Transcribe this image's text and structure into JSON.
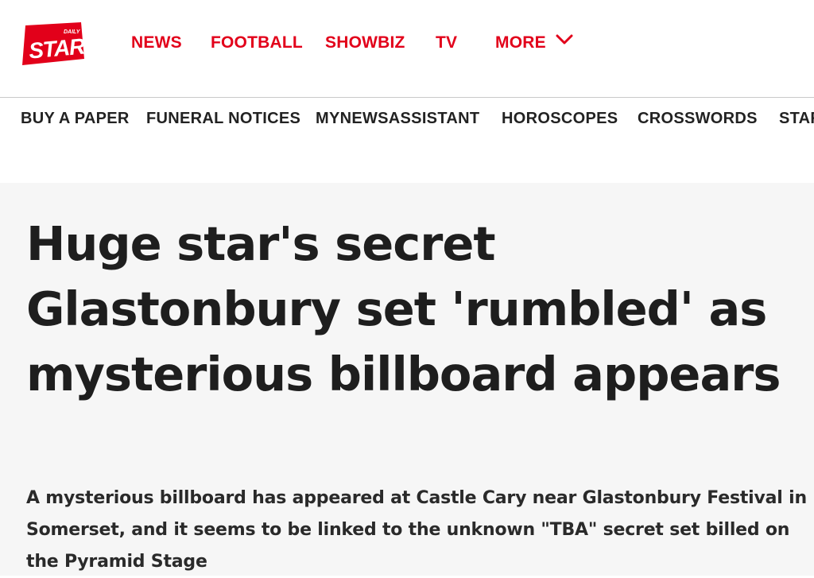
{
  "brand": {
    "logo_top": "DAILY",
    "logo_main": "STAR",
    "color": "#e2001a"
  },
  "main_nav": {
    "items": [
      "NEWS",
      "FOOTBALL",
      "SHOWBIZ",
      "TV",
      "MORE"
    ],
    "more_icon": "chevron-down-icon"
  },
  "sub_nav": {
    "items": [
      "BUY A PAPER",
      "FUNERAL NOTICES",
      "MYNEWSASSISTANT",
      "HOROSCOPES",
      "CROSSWORDS",
      "STAR"
    ]
  },
  "article": {
    "headline": "Huge star's secret Glastonbury set 'rumbled' as mysterious billboard appears",
    "standfirst": "A mysterious billboard has appeared at Castle Cary near Glastonbury Festival in Somerset, and it seems to be linked to the unknown \"TBA\" secret set billed on the Pyramid Stage"
  }
}
